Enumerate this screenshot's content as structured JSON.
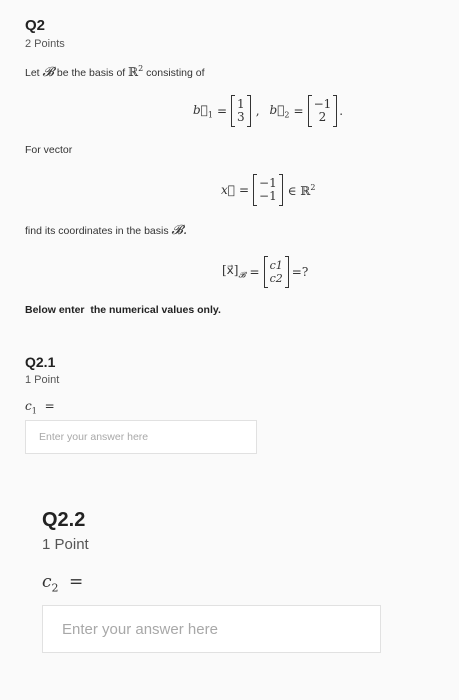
{
  "q2": {
    "title": "Q2",
    "points": "2 Points",
    "intro_prefix": "Let",
    "basis_symbol": "𝓑",
    "intro_mid": "be the basis of",
    "space": "ℝ",
    "space_exp": "2",
    "intro_suffix": "consisting of",
    "b1_label": "b⃗",
    "b1_sub": "1",
    "b1_vals": [
      "1",
      "3"
    ],
    "b2_label": "b⃗",
    "b2_sub": "2",
    "b2_vals": [
      "−1",
      "2"
    ],
    "for_vector": "For vector",
    "x_label": "x⃗",
    "x_vals": [
      "−1",
      "−1"
    ],
    "in_space": "∈ ℝ",
    "in_space_exp": "2",
    "find_text": "find its coordinates in the basis",
    "find_basis": "𝓑.",
    "coord_lhs": "[x⃗]",
    "coord_sub": "𝓑",
    "coord_vals": [
      "c1",
      "c2"
    ],
    "coord_rhs": "=?",
    "note": "Below enter  the numerical values only."
  },
  "q21": {
    "title": "Q2.1",
    "points": "1 Point",
    "var_label": "c",
    "var_sub": "1",
    "eq": "=",
    "placeholder": "Enter your answer here"
  },
  "q22": {
    "title": "Q2.2",
    "points": "1 Point",
    "var_label": "c",
    "var_sub": "2",
    "eq": "=",
    "placeholder": "Enter your answer here"
  }
}
